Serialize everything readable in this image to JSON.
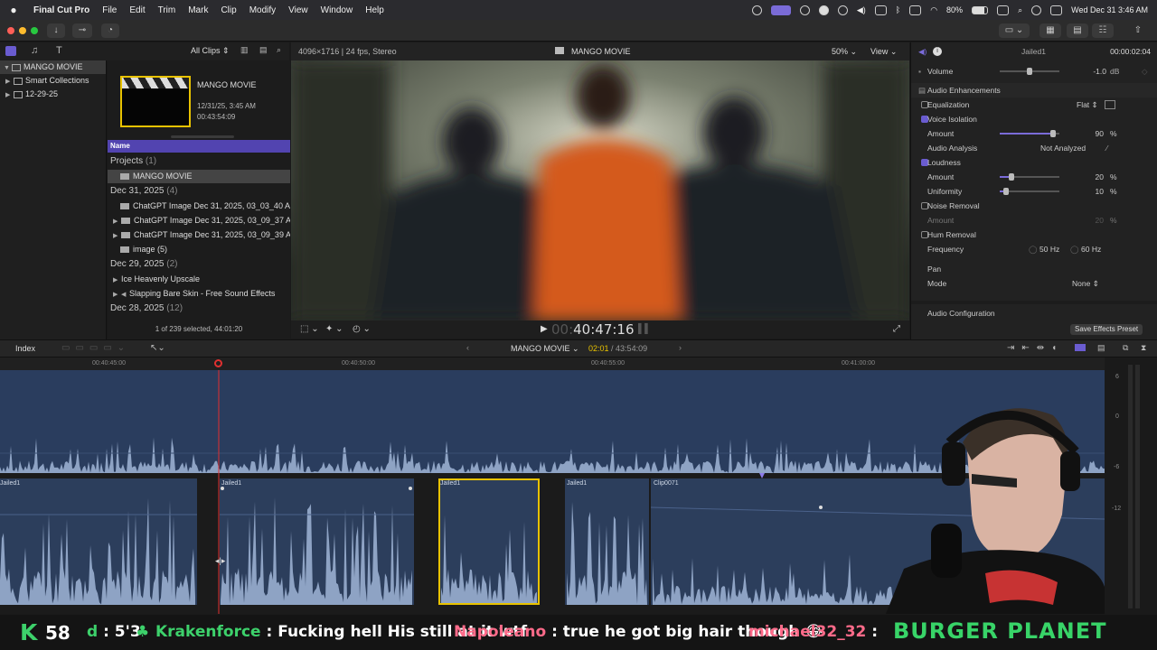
{
  "menubar": {
    "app": "Final Cut Pro",
    "items": [
      "File",
      "Edit",
      "Trim",
      "Mark",
      "Clip",
      "Modify",
      "View",
      "Window",
      "Help"
    ],
    "battery": "80%",
    "datetime": "Wed Dec 31  3:46 AM"
  },
  "library": {
    "clips_filter": "All Clips",
    "sidebar": [
      {
        "label": "MANGO MOVIE",
        "selected": true,
        "icon": "library-icon"
      },
      {
        "label": "Smart Collections",
        "selected": false,
        "icon": "folder-icon"
      },
      {
        "label": "12-29-25",
        "selected": false,
        "icon": "event-icon"
      }
    ]
  },
  "browser": {
    "project_title": "MANGO MOVIE",
    "project_date": "12/31/25, 3:45 AM",
    "project_duration": "00:43:54:09",
    "column_name": "Name",
    "groups": {
      "projects": {
        "label": "Projects",
        "count": "(1)"
      },
      "dec31": {
        "label": "Dec 31, 2025",
        "count": "(4)"
      },
      "dec29": {
        "label": "Dec 29, 2025",
        "count": "(2)"
      },
      "dec28": {
        "label": "Dec 28, 2025",
        "count": "(12)"
      }
    },
    "rows": {
      "project": "MANGO MOVIE",
      "r1": "ChatGPT Image Dec 31, 2025, 03_03_40 A",
      "r2": "ChatGPT Image Dec 31, 2025, 03_09_37 AI",
      "r3": "ChatGPT Image Dec 31, 2025, 03_09_39 A",
      "r4": "image (5)",
      "r5": "Ice Heavenly Upscale",
      "r6": "Slapping Bare Skin - Free Sound Effects"
    },
    "status": "1 of 239 selected, 44:01:20"
  },
  "viewer": {
    "format": "4096×1716 | 24 fps, Stereo",
    "title": "MANGO MOVIE",
    "zoom": "50%",
    "view_label": "View",
    "timecode_prefix": "00:",
    "timecode": "40:47:16"
  },
  "inspector": {
    "clip_name": "Jailed1",
    "clip_duration": "00:00:02:04",
    "volume_label": "Volume",
    "volume_value": "-1.0",
    "volume_unit": "dB",
    "enhancements_title": "Audio Enhancements",
    "equalization_label": "Equalization",
    "equalization_value": "Flat",
    "voice_isolation_label": "Voice Isolation",
    "voice_isolation_enabled": true,
    "vi_amount_label": "Amount",
    "vi_amount_value": "90",
    "vi_amount_level": 0.9,
    "audio_analysis_label": "Audio Analysis",
    "audio_analysis_value": "Not Analyzed",
    "loudness_label": "Loudness",
    "loudness_enabled": true,
    "loud_amount_label": "Amount",
    "loud_amount_value": "20",
    "loud_amount_level": 0.2,
    "uniformity_label": "Uniformity",
    "uniformity_value": "10",
    "uniformity_level": 0.1,
    "noise_removal_label": "Noise Removal",
    "noise_removal_enabled": false,
    "nr_amount_label": "Amount",
    "nr_amount_value": "20",
    "hum_removal_label": "Hum Removal",
    "hum_removal_enabled": false,
    "frequency_label": "Frequency",
    "freq_50": "50",
    "freq_60": "60",
    "freq_unit": "Hz",
    "pan_title": "Pan",
    "mode_label": "Mode",
    "mode_value": "None",
    "audio_config": "Audio Configuration",
    "save_preset": "Save Effects Preset",
    "percent": "%"
  },
  "timeline": {
    "index_label": "Index",
    "project": "MANGO MOVIE",
    "position": "02:01",
    "total": "43:54:09",
    "ruler": [
      "00:40:45:00",
      "00:40:50:00",
      "00:40:55:00",
      "00:41:00:00"
    ],
    "clips": [
      "Jailed1",
      "Jailed1",
      "Jailed1",
      "Jailed1",
      "Clip0071"
    ],
    "meter_scale": [
      "6",
      "0",
      "-6",
      "-12"
    ]
  },
  "chat": {
    "k_label": "K",
    "viewer_count": "58",
    "partial_user": "d",
    "partial_msg": " : 5'3",
    "user1": "Krakenforce",
    "msg1": " : Fucking hell His still at it wtf",
    "user2": "Napoleano",
    "msg2": " : true he got big hair though 😂",
    "user3": "michael32_32",
    "msg3": " : ",
    "banner": "BURGER PLANET"
  },
  "colors": {
    "accent": "#7a6bd8",
    "selection_yellow": "#e8c200",
    "chat_green": "#3dd16b",
    "chat_pink": "#ff6b8a",
    "waveform": "#8ea3c4",
    "clip_bg": "#2c3e5c"
  }
}
